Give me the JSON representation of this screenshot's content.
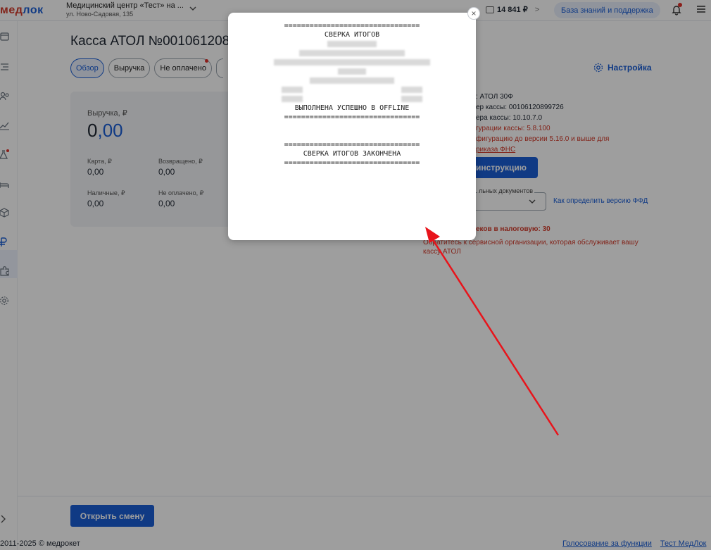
{
  "header": {
    "logo_part1": "мед",
    "logo_part2": "лок",
    "clinic_name": "Медицинский центр «Тест» на ...",
    "clinic_address": "ул. Ново-Садовая, 135",
    "balance": "14 841 ₽",
    "balance_arrow": ">",
    "knowledge_base_label": "База знаний и поддержка"
  },
  "page": {
    "title": "Касса АТОЛ №001061208",
    "tabs": [
      {
        "label": "Обзор",
        "active": true
      },
      {
        "label": "Выручка",
        "active": false
      },
      {
        "label": "Не оплачено",
        "active": false,
        "badge": true
      }
    ],
    "settings_label": "Настройка"
  },
  "revenue_card": {
    "title": "Выручка, ₽",
    "total_int": "0",
    "total_dec": ",00",
    "card_label": "Карта, ₽",
    "card_value": "0,00",
    "returned_label": "Возвращено, ₽",
    "returned_value": "0,00",
    "cash_label": "Наличные, ₽",
    "cash_value": "0,00",
    "unpaid_label": "Не оплачено, ₽",
    "unpaid_value": "0,00"
  },
  "info": {
    "model": ": АТОЛ 30Ф",
    "serial": "ер кассы: 00106120899726",
    "version": "ера кассы: 10.10.7.0",
    "config": "гурации кассы: 5.8.100",
    "config_note": "фигурацию до версии 5.16.0 и выше для",
    "order_link": "риказа ФНС",
    "instruction_button": "инструкцию",
    "ffd_legend": "льных документов",
    "ffd_link": "Как определить версию ФФД",
    "tax_text": "еков в налоговую: 30",
    "tax_note": "Обратитесь к сервисной организации, которая обслуживает вашу кассу АТОЛ"
  },
  "footer": {
    "open_shift_button": "Открыть смену",
    "copyright": "2011-2025 © медрокет",
    "link_vote": "Голосование за функции",
    "link_test": "Тест МедЛок"
  },
  "modal": {
    "close_label": "×",
    "separator": "================================",
    "receipt_title": "СВЕРКА ИТОГОВ",
    "receipt_status": "ВЫПОЛНЕНА УСПЕШНО В OFFLINE",
    "receipt_end": "СВЕРКА ИТОГОВ ЗАКОНЧЕНА"
  },
  "colors": {
    "accent": "#1a5ed6",
    "danger": "#d23a2b",
    "arrow": "#e8141b"
  }
}
